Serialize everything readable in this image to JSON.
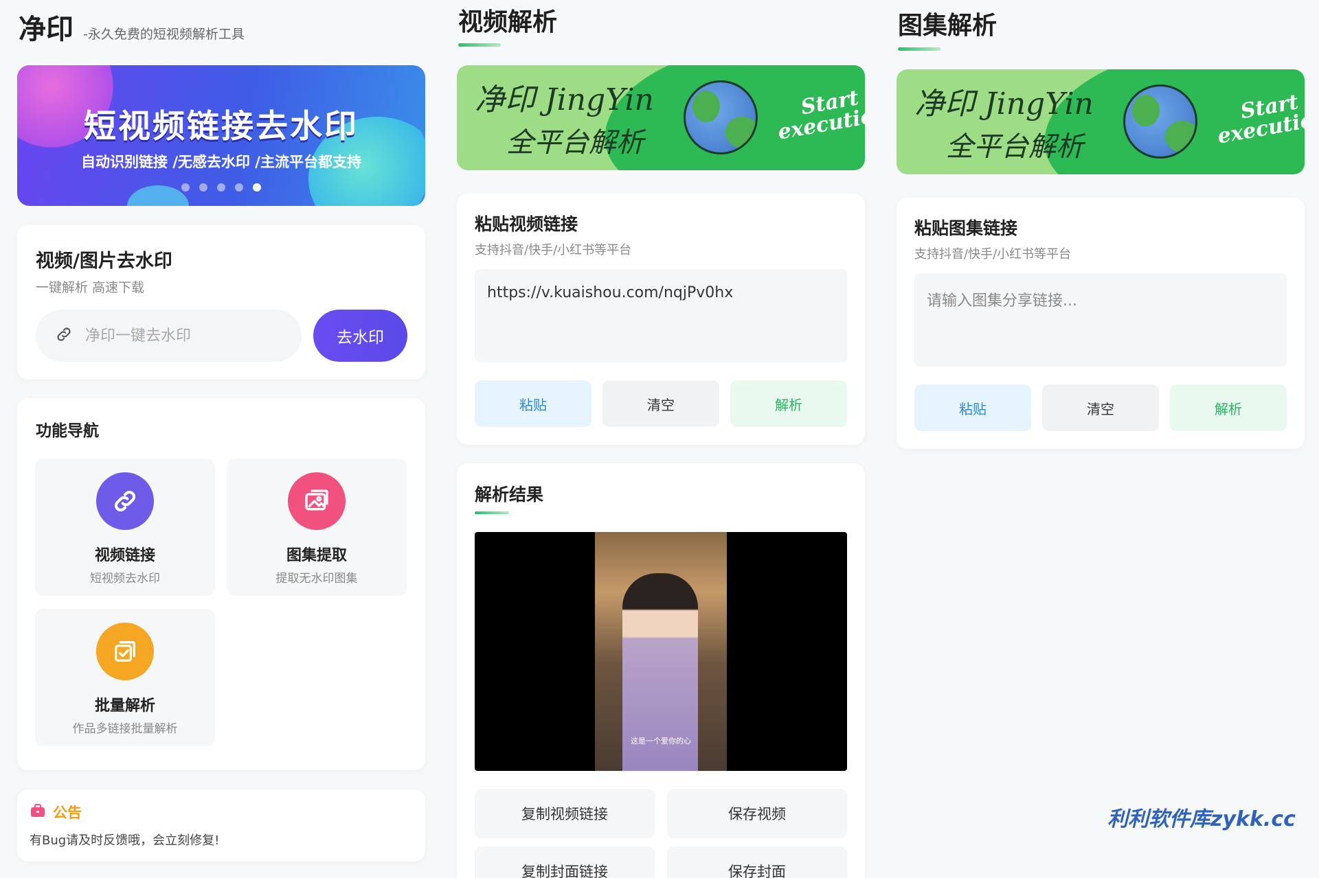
{
  "colors": {
    "primary": "#5a49e8",
    "green": "#28b463",
    "blue": "#2f86d6",
    "orange": "#f5a623",
    "pink": "#f0517e",
    "watermark": "#2f62b8"
  },
  "home": {
    "brand_title": "净印",
    "brand_subtitle": "-永久免费的短视频解析工具",
    "banner": {
      "title": "短视频链接去水印",
      "subtitle": "自动识别链接 /无感去水印 /主流平台都支持",
      "dots": 5,
      "active_dot": 5
    },
    "remove_card": {
      "title": "视频/图片去水印",
      "subtitle": "一键解析 高速下载",
      "input_placeholder": "净印一键去水印",
      "button": "去水印",
      "icon": "link-icon"
    },
    "nav": {
      "title": "功能导航",
      "items": [
        {
          "title": "视频链接",
          "subtitle": "短视频去水印",
          "icon": "link-icon",
          "color": "#6c5ce7"
        },
        {
          "title": "图集提取",
          "subtitle": "提取无水印图集",
          "icon": "images-icon",
          "color": "#f0517e"
        },
        {
          "title": "批量解析",
          "subtitle": "作品多链接批量解析",
          "icon": "batch-icon",
          "color": "#f5a623"
        }
      ]
    },
    "notice": {
      "title": "公告",
      "text": "有Bug请及时反馈哦，会立刻修复!",
      "icon": "notice-icon"
    }
  },
  "video": {
    "section_title": "视频解析",
    "banner": {
      "line1": "净印 JingYin",
      "line2": "全平台解析",
      "start": "Start",
      "execution": "execution"
    },
    "paste_card": {
      "title": "粘贴视频链接",
      "subtitle": "支持抖音/快手/小红书等平台",
      "value": "https://v.kuaishou.com/nqjPv0hx"
    },
    "buttons": {
      "paste": "粘贴",
      "clear": "清空",
      "parse": "解析"
    },
    "result": {
      "title": "解析结果",
      "caption": "这是一个爱你的心",
      "buttons": [
        "复制视频链接",
        "保存视频",
        "复制封面链接",
        "保存封面"
      ]
    }
  },
  "gallery": {
    "section_title": "图集解析",
    "paste_card": {
      "title": "粘贴图集链接",
      "subtitle": "支持抖音/快手/小红书等平台",
      "placeholder": "请输入图集分享链接..."
    },
    "buttons": {
      "paste": "粘贴",
      "clear": "清空",
      "parse": "解析"
    }
  },
  "watermark": "利利软件库zykk.cc"
}
